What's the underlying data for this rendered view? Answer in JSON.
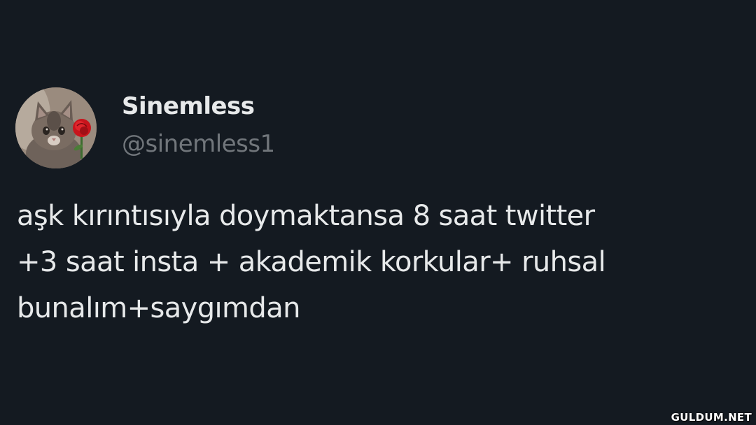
{
  "author": {
    "display_name": "Sinemless",
    "handle": "@sinemless1",
    "avatar_icon": "cat-with-rose-avatar"
  },
  "tweet": {
    "lines": [
      "aşk kırıntısıyla doymaktansa 8 saat twitter",
      "+3 saat insta + akademik korkular+ ruhsal",
      "bunalım+saygımdan"
    ]
  },
  "watermark": "GULDUM.NET",
  "colors": {
    "background": "#141a21",
    "primary_text": "#e7e9ea",
    "secondary_text": "#71767b"
  }
}
